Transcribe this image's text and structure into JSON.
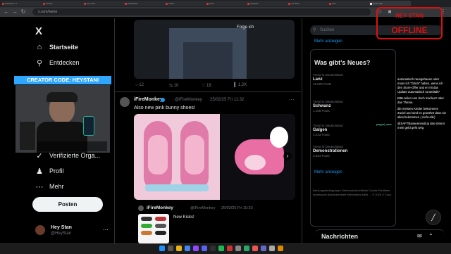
{
  "browser": {
    "tabs": [
      "Startseite / X",
      "Stream",
      "Hey Stan",
      "Dashboard",
      "Twitch",
      "Chat",
      "Ausgabe",
      "YouTube",
      "Ahh",
      "Neuer Tab"
    ],
    "url": "x.com/home"
  },
  "sidebar": {
    "logo": "X",
    "items": [
      {
        "label": "Startseite",
        "icon": "home-icon"
      },
      {
        "label": "Entdecken",
        "icon": "search-icon"
      },
      {
        "label": "Verifizierte Orga...",
        "icon": "verified-icon"
      },
      {
        "label": "Profil",
        "icon": "profile-icon"
      },
      {
        "label": "Mehr",
        "icon": "more-icon"
      }
    ],
    "post_button": "Posten",
    "account": {
      "name": "Hey Stan",
      "handle": "@HeyStan"
    }
  },
  "overlay": {
    "creator_code": "CREATOR CODE: HEYSTANI",
    "offline_badge": "OFFLINE",
    "offline_small": "HEY STAN"
  },
  "timeline": {
    "top_post": {
      "replies": "12",
      "reposts": "10",
      "likes": "18",
      "views": "1,2K"
    },
    "follow_label": "Folge ich",
    "post": {
      "author": "iFireMonkey",
      "handle": "@iFireMonkey",
      "time": "25/02/25 Fri 11:32",
      "text": "Also new pink bunny shoes!"
    },
    "quoted": {
      "author": "iFireMonkey",
      "handle": "@iFireMonkey",
      "time": "25/02/25 Fri 10:33",
      "text": "New Kicks!"
    }
  },
  "right": {
    "search_placeholder": "Suchen",
    "show_more_top": "Mehr anzeigen",
    "whats_new": "Was gibt’s Neues?",
    "trends": [
      {
        "cat": "Trend in Deutschland",
        "name": "Lanz",
        "cnt": "15.600 Posts"
      },
      {
        "cat": "Trend in Deutschland",
        "name": "Schwanz",
        "cnt": "1.166 Posts"
      },
      {
        "cat": "Trend in Deutschland",
        "name": "Galgen",
        "cnt": "1.243 Posts"
      },
      {
        "cat": "Trend in Deutschland",
        "name": "Demonstrationen",
        "cnt": "3.834 Posts"
      }
    ],
    "show_more": "Mehr anzeigen",
    "footer": "Nutzungsbedingungen  Datenschutzrichtlinie  Cookie-Richtlinie  Impressum  Barrierefreiheit  Werbeinfos  Mehr ...  © 2025 X Corp.",
    "messages": "Nachrichten"
  },
  "chat": [
    {
      "user": "",
      "msg": "automatisch rausgehauen oder muss ich \"Glück\" haben, wenn ich den Store-Offer und er mit das Update automatisch runterlädt?"
    },
    {
      "user": "",
      "msg": "Bitte teilen uns doch mal kurz über das Thema"
    },
    {
      "user": "paypal_user",
      "msg": "die meisten Kinder bekommen Zuviel und sind es gewöhnt dass sie alles bekommen ( nicht alle)"
    },
    {
      "user": "",
      "msg": "@SAFTBananenmall ja das stimmt mein geld geht weg"
    }
  ],
  "colors": {
    "accent": "#1d9bf0",
    "offline": "#d11",
    "creator_bar": "#2fa6ff",
    "pink": "#e7a3c2"
  }
}
